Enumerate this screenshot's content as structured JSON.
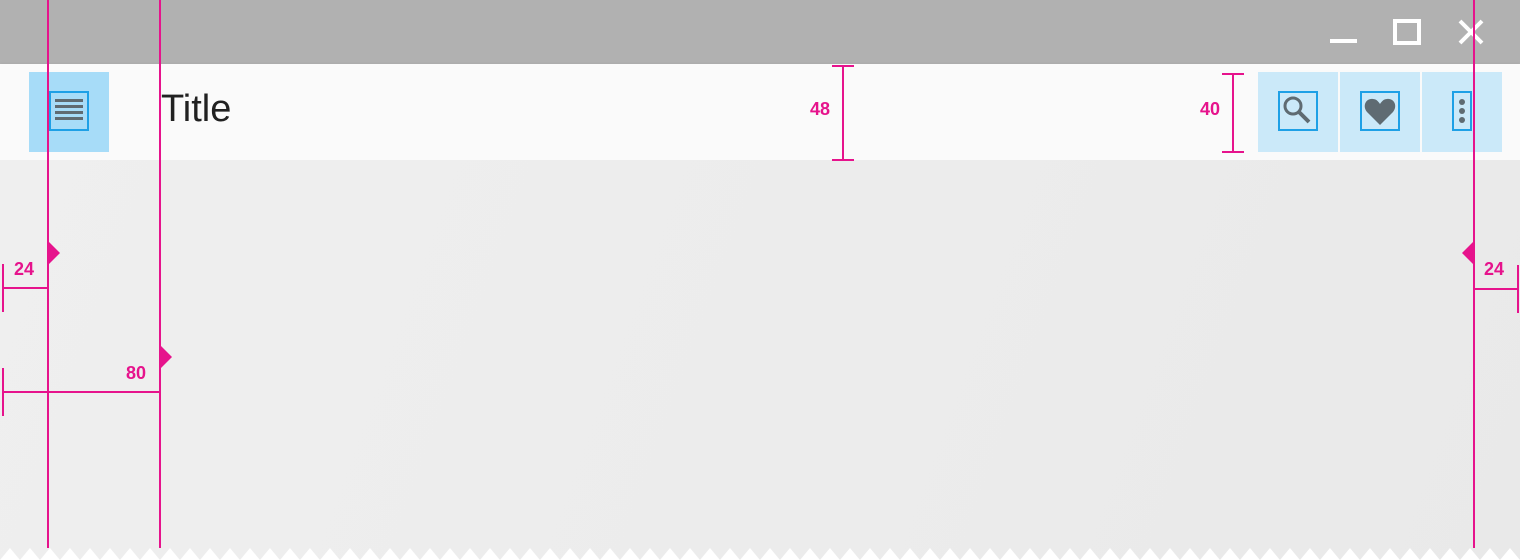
{
  "app_bar": {
    "title": "Title",
    "nav_icon": "menu-icon",
    "actions": [
      {
        "icon": "search-icon"
      },
      {
        "icon": "heart-icon"
      },
      {
        "icon": "more-vert-icon"
      }
    ]
  },
  "window_controls": [
    "minimize-icon",
    "maximize-icon",
    "close-icon"
  ],
  "measurements": {
    "left_margin": "24",
    "title_keyline": "80",
    "bar_height": "48",
    "icon_height": "40",
    "right_margin": "24"
  },
  "colors": {
    "titlebar": "#b1b1b1",
    "appbar": "#fafafa",
    "touch_target": "#a7dcf8",
    "icon_outline": "#1ea0e6",
    "icon_fill": "#5f6b72",
    "redline": "#e6138c"
  }
}
